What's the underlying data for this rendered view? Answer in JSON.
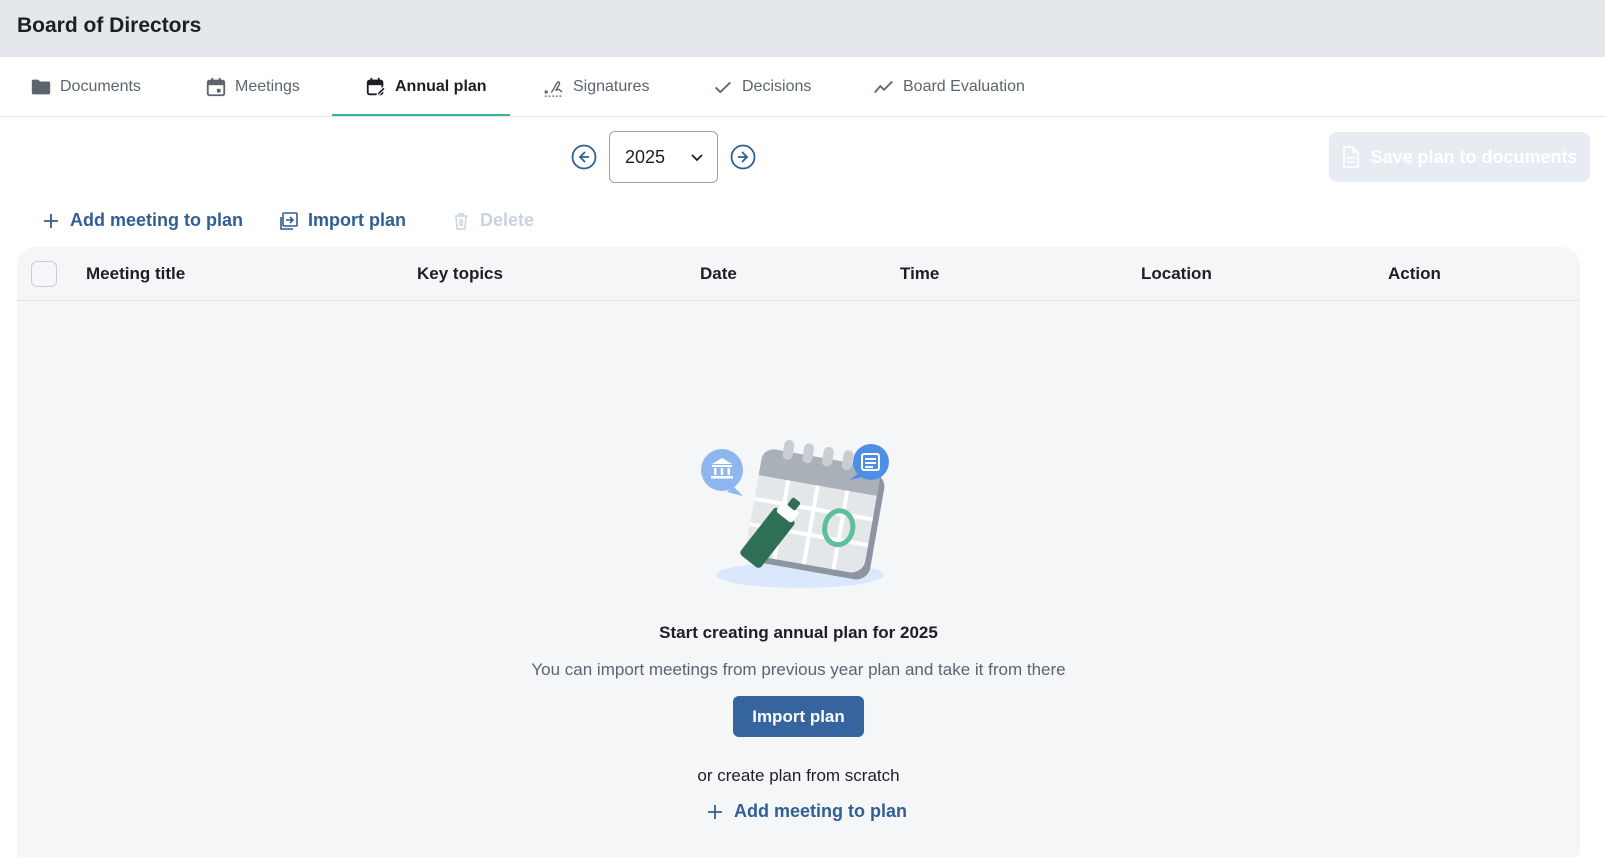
{
  "header": {
    "title": "Board of Directors"
  },
  "tabs": [
    {
      "label": "Documents",
      "icon": "folder-icon"
    },
    {
      "label": "Meetings",
      "icon": "calendar-icon"
    },
    {
      "label": "Annual plan",
      "icon": "calendar-edit-icon",
      "active": true
    },
    {
      "label": "Signatures",
      "icon": "signature-icon"
    },
    {
      "label": "Decisions",
      "icon": "check-icon"
    },
    {
      "label": "Board Evaluation",
      "icon": "trend-icon"
    }
  ],
  "year_nav": {
    "selected_year": "2025"
  },
  "toolbar": {
    "save_label": "Save plan to documents",
    "add_label": "Add meeting to plan",
    "import_label": "Import plan",
    "delete_label": "Delete"
  },
  "table": {
    "columns": [
      "Meeting title",
      "Key topics",
      "Date",
      "Time",
      "Location",
      "Action"
    ],
    "rows": []
  },
  "empty_state": {
    "title": "Start creating annual plan for 2025",
    "subtitle": "You can import meetings from previous year plan and take it from there",
    "import_button": "Import plan",
    "or_text": "or create plan from scratch",
    "add_link": "Add meeting to plan"
  },
  "colors": {
    "accent": "#35649f",
    "link": "#2f5f94",
    "tab_underline": "#39b39a",
    "header_bg": "#e4e8ec",
    "table_bg": "#f5f6f8"
  }
}
